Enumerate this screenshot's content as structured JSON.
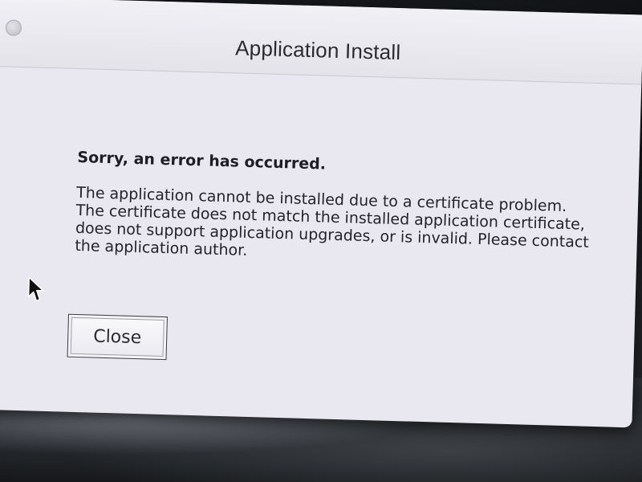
{
  "window": {
    "title": "Application Install"
  },
  "dialog": {
    "heading": "Sorry, an error has occurred.",
    "message": "The application cannot be installed due to a certificate problem.  The certificate does not match the installed application certificate, does not support application upgrades, or is invalid.  Please contact the application author.",
    "close_label": "Close"
  },
  "icons": {
    "window_button": "window-control-icon",
    "pointer": "mouse-pointer-icon"
  },
  "colors": {
    "window_background": "#e9e8f0",
    "text": "#1e1e24"
  }
}
